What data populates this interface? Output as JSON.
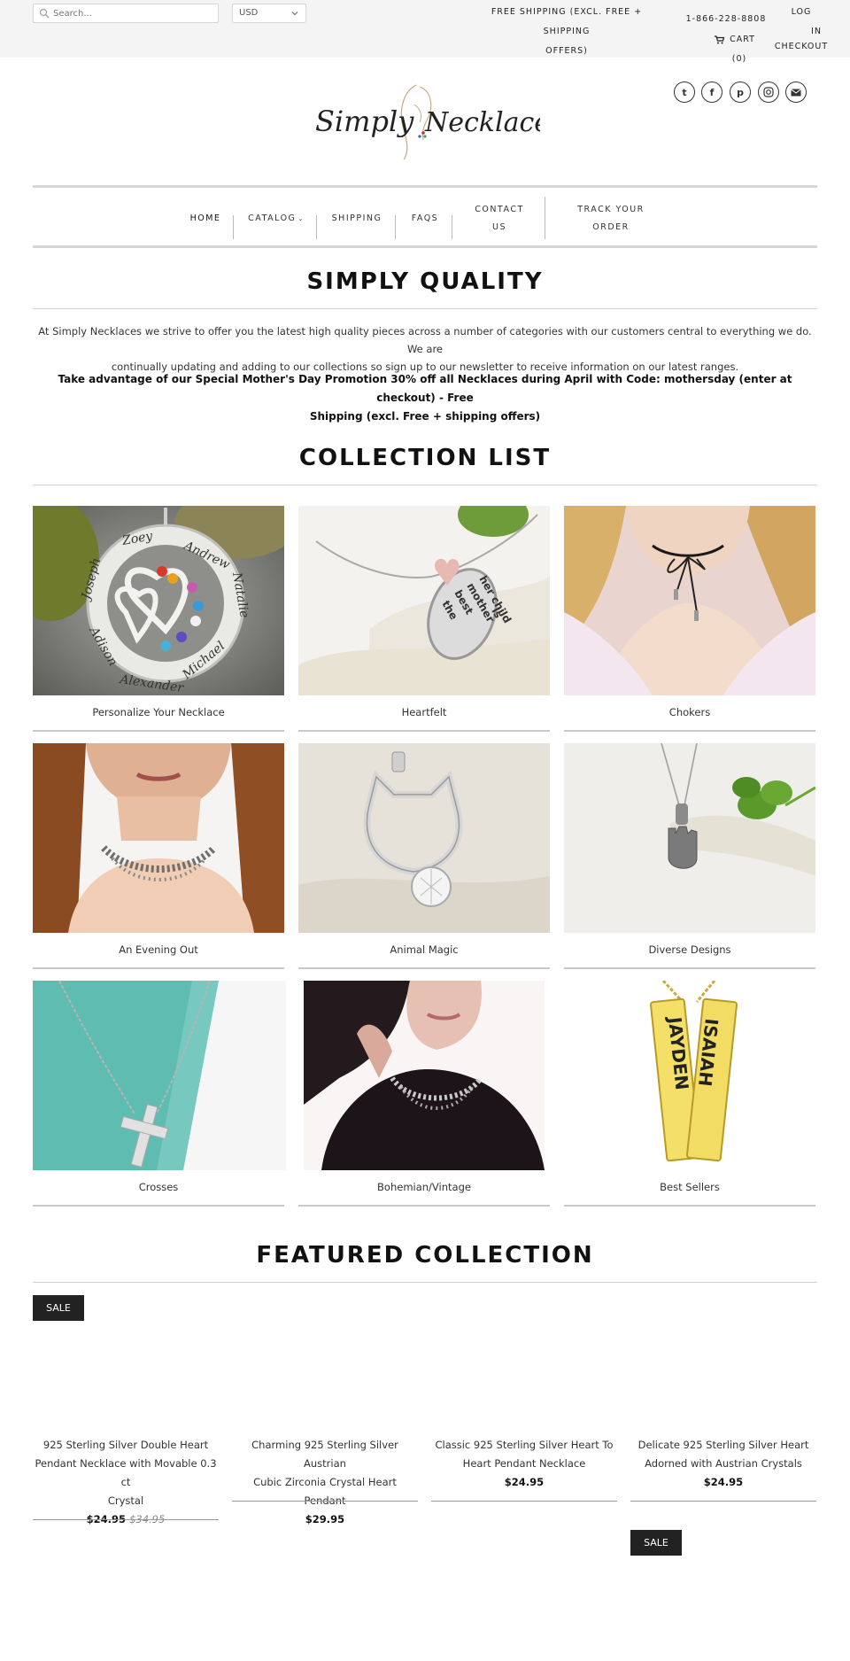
{
  "topbar": {
    "search_placeholder": "Search...",
    "currency": "USD",
    "shipping_line1": "FREE SHIPPING (EXCL. FREE + SHIPPING",
    "shipping_line2": "OFFERS)",
    "phone": "1-866-228-8808",
    "cart_label": "CART",
    "cart_count": "(0)",
    "login_line1": "LOG",
    "login_line2": "IN",
    "checkout": "CHECKOUT"
  },
  "header": {
    "logo_text_left": "Simply",
    "logo_text_right": "Necklaces",
    "social": [
      {
        "icon": "twitter-icon",
        "glyph": "t"
      },
      {
        "icon": "facebook-icon",
        "glyph": "f"
      },
      {
        "icon": "pinterest-icon",
        "glyph": "p"
      },
      {
        "icon": "instagram-icon",
        "glyph": "◎"
      },
      {
        "icon": "email-icon",
        "glyph": "✉"
      }
    ]
  },
  "nav": {
    "home": "HOME",
    "catalog": "CATALOG",
    "shipping": "SHIPPING",
    "faqs": "FAQS",
    "contact_line1": "CONTACT",
    "contact_line2": "US",
    "track_line1": "TRACK YOUR",
    "track_line2": "ORDER"
  },
  "intro": {
    "heading": "SIMPLY QUALITY",
    "paragraph_line1": "At Simply Necklaces we strive to offer you the latest high quality pieces across a number of categories with our customers central to everything we do. We are",
    "paragraph_line2": "continually updating and adding to our collections so sign up to our newsletter to receive information on our latest ranges.",
    "promo_line1": "Take advantage of our Special Mother's Day Promotion 30% off all Necklaces during April with Code: mothersday (enter at checkout) - Free",
    "promo_line2": "Shipping (excl. Free + shipping offers)"
  },
  "collections": {
    "heading": "COLLECTION LIST",
    "items": [
      {
        "label": "Personalize Your Necklace"
      },
      {
        "label": "Heartfelt"
      },
      {
        "label": "Chokers"
      },
      {
        "label": "An Evening Out"
      },
      {
        "label": "Animal Magic"
      },
      {
        "label": "Diverse Designs"
      },
      {
        "label": "Crosses"
      },
      {
        "label": "Bohemian/Vintage"
      },
      {
        "label": "Best Sellers"
      }
    ],
    "engraved": {
      "names_ring": [
        "Andrew",
        "Zoey",
        "Joseph",
        "Natalie",
        "Adison",
        "Alexander",
        "Michael"
      ],
      "heart_pendant": [
        "the",
        "best",
        "mother",
        "her child",
        "is"
      ],
      "bars": [
        "JAYDEN",
        "ISAIAH"
      ]
    }
  },
  "featured": {
    "heading": "FEATURED COLLECTION",
    "sale_badge": "SALE",
    "products": [
      {
        "title_line1": "925 Sterling Silver Double Heart",
        "title_line2": "Pendant Necklace with Movable 0.3 ct",
        "title_line3": "Crystal",
        "price": "$24.95",
        "was": "$34.95"
      },
      {
        "title_line1": "Charming 925 Sterling Silver Austrian",
        "title_line2": "Cubic Zirconia Crystal Heart Pendant",
        "price": "$29.95"
      },
      {
        "title_line1": "Classic 925 Sterling Silver Heart To",
        "title_line2": "Heart Pendant Necklace",
        "price": "$24.95"
      },
      {
        "title_line1": "Delicate 925 Sterling Silver Heart",
        "title_line2": "Adorned with Austrian Crystals",
        "price": "$24.95"
      }
    ]
  },
  "colors": {
    "topbar_bg": "#f4f4f4",
    "badge_bg": "#222222",
    "rule": "#d5d5d5"
  }
}
